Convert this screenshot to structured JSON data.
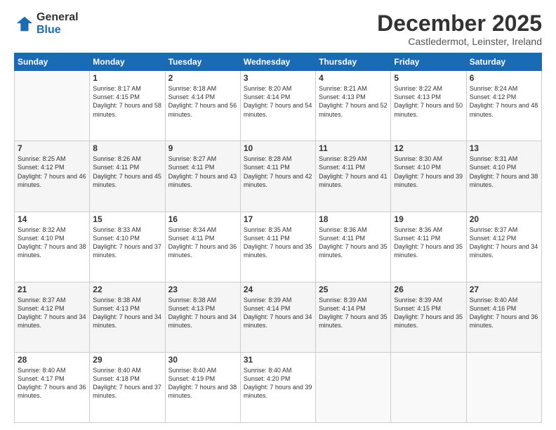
{
  "logo": {
    "general": "General",
    "blue": "Blue"
  },
  "header": {
    "month": "December 2025",
    "location": "Castledermot, Leinster, Ireland"
  },
  "days_of_week": [
    "Sunday",
    "Monday",
    "Tuesday",
    "Wednesday",
    "Thursday",
    "Friday",
    "Saturday"
  ],
  "weeks": [
    [
      {
        "day": "",
        "sunrise": "",
        "sunset": "",
        "daylight": ""
      },
      {
        "day": "1",
        "sunrise": "Sunrise: 8:17 AM",
        "sunset": "Sunset: 4:15 PM",
        "daylight": "Daylight: 7 hours and 58 minutes."
      },
      {
        "day": "2",
        "sunrise": "Sunrise: 8:18 AM",
        "sunset": "Sunset: 4:14 PM",
        "daylight": "Daylight: 7 hours and 56 minutes."
      },
      {
        "day": "3",
        "sunrise": "Sunrise: 8:20 AM",
        "sunset": "Sunset: 4:14 PM",
        "daylight": "Daylight: 7 hours and 54 minutes."
      },
      {
        "day": "4",
        "sunrise": "Sunrise: 8:21 AM",
        "sunset": "Sunset: 4:13 PM",
        "daylight": "Daylight: 7 hours and 52 minutes."
      },
      {
        "day": "5",
        "sunrise": "Sunrise: 8:22 AM",
        "sunset": "Sunset: 4:13 PM",
        "daylight": "Daylight: 7 hours and 50 minutes."
      },
      {
        "day": "6",
        "sunrise": "Sunrise: 8:24 AM",
        "sunset": "Sunset: 4:12 PM",
        "daylight": "Daylight: 7 hours and 48 minutes."
      }
    ],
    [
      {
        "day": "7",
        "sunrise": "Sunrise: 8:25 AM",
        "sunset": "Sunset: 4:12 PM",
        "daylight": "Daylight: 7 hours and 46 minutes."
      },
      {
        "day": "8",
        "sunrise": "Sunrise: 8:26 AM",
        "sunset": "Sunset: 4:11 PM",
        "daylight": "Daylight: 7 hours and 45 minutes."
      },
      {
        "day": "9",
        "sunrise": "Sunrise: 8:27 AM",
        "sunset": "Sunset: 4:11 PM",
        "daylight": "Daylight: 7 hours and 43 minutes."
      },
      {
        "day": "10",
        "sunrise": "Sunrise: 8:28 AM",
        "sunset": "Sunset: 4:11 PM",
        "daylight": "Daylight: 7 hours and 42 minutes."
      },
      {
        "day": "11",
        "sunrise": "Sunrise: 8:29 AM",
        "sunset": "Sunset: 4:11 PM",
        "daylight": "Daylight: 7 hours and 41 minutes."
      },
      {
        "day": "12",
        "sunrise": "Sunrise: 8:30 AM",
        "sunset": "Sunset: 4:10 PM",
        "daylight": "Daylight: 7 hours and 39 minutes."
      },
      {
        "day": "13",
        "sunrise": "Sunrise: 8:31 AM",
        "sunset": "Sunset: 4:10 PM",
        "daylight": "Daylight: 7 hours and 38 minutes."
      }
    ],
    [
      {
        "day": "14",
        "sunrise": "Sunrise: 8:32 AM",
        "sunset": "Sunset: 4:10 PM",
        "daylight": "Daylight: 7 hours and 38 minutes."
      },
      {
        "day": "15",
        "sunrise": "Sunrise: 8:33 AM",
        "sunset": "Sunset: 4:10 PM",
        "daylight": "Daylight: 7 hours and 37 minutes."
      },
      {
        "day": "16",
        "sunrise": "Sunrise: 8:34 AM",
        "sunset": "Sunset: 4:11 PM",
        "daylight": "Daylight: 7 hours and 36 minutes."
      },
      {
        "day": "17",
        "sunrise": "Sunrise: 8:35 AM",
        "sunset": "Sunset: 4:11 PM",
        "daylight": "Daylight: 7 hours and 35 minutes."
      },
      {
        "day": "18",
        "sunrise": "Sunrise: 8:36 AM",
        "sunset": "Sunset: 4:11 PM",
        "daylight": "Daylight: 7 hours and 35 minutes."
      },
      {
        "day": "19",
        "sunrise": "Sunrise: 8:36 AM",
        "sunset": "Sunset: 4:11 PM",
        "daylight": "Daylight: 7 hours and 35 minutes."
      },
      {
        "day": "20",
        "sunrise": "Sunrise: 8:37 AM",
        "sunset": "Sunset: 4:12 PM",
        "daylight": "Daylight: 7 hours and 34 minutes."
      }
    ],
    [
      {
        "day": "21",
        "sunrise": "Sunrise: 8:37 AM",
        "sunset": "Sunset: 4:12 PM",
        "daylight": "Daylight: 7 hours and 34 minutes."
      },
      {
        "day": "22",
        "sunrise": "Sunrise: 8:38 AM",
        "sunset": "Sunset: 4:13 PM",
        "daylight": "Daylight: 7 hours and 34 minutes."
      },
      {
        "day": "23",
        "sunrise": "Sunrise: 8:38 AM",
        "sunset": "Sunset: 4:13 PM",
        "daylight": "Daylight: 7 hours and 34 minutes."
      },
      {
        "day": "24",
        "sunrise": "Sunrise: 8:39 AM",
        "sunset": "Sunset: 4:14 PM",
        "daylight": "Daylight: 7 hours and 34 minutes."
      },
      {
        "day": "25",
        "sunrise": "Sunrise: 8:39 AM",
        "sunset": "Sunset: 4:14 PM",
        "daylight": "Daylight: 7 hours and 35 minutes."
      },
      {
        "day": "26",
        "sunrise": "Sunrise: 8:39 AM",
        "sunset": "Sunset: 4:15 PM",
        "daylight": "Daylight: 7 hours and 35 minutes."
      },
      {
        "day": "27",
        "sunrise": "Sunrise: 8:40 AM",
        "sunset": "Sunset: 4:16 PM",
        "daylight": "Daylight: 7 hours and 36 minutes."
      }
    ],
    [
      {
        "day": "28",
        "sunrise": "Sunrise: 8:40 AM",
        "sunset": "Sunset: 4:17 PM",
        "daylight": "Daylight: 7 hours and 36 minutes."
      },
      {
        "day": "29",
        "sunrise": "Sunrise: 8:40 AM",
        "sunset": "Sunset: 4:18 PM",
        "daylight": "Daylight: 7 hours and 37 minutes."
      },
      {
        "day": "30",
        "sunrise": "Sunrise: 8:40 AM",
        "sunset": "Sunset: 4:19 PM",
        "daylight": "Daylight: 7 hours and 38 minutes."
      },
      {
        "day": "31",
        "sunrise": "Sunrise: 8:40 AM",
        "sunset": "Sunset: 4:20 PM",
        "daylight": "Daylight: 7 hours and 39 minutes."
      },
      {
        "day": "",
        "sunrise": "",
        "sunset": "",
        "daylight": ""
      },
      {
        "day": "",
        "sunrise": "",
        "sunset": "",
        "daylight": ""
      },
      {
        "day": "",
        "sunrise": "",
        "sunset": "",
        "daylight": ""
      }
    ]
  ]
}
